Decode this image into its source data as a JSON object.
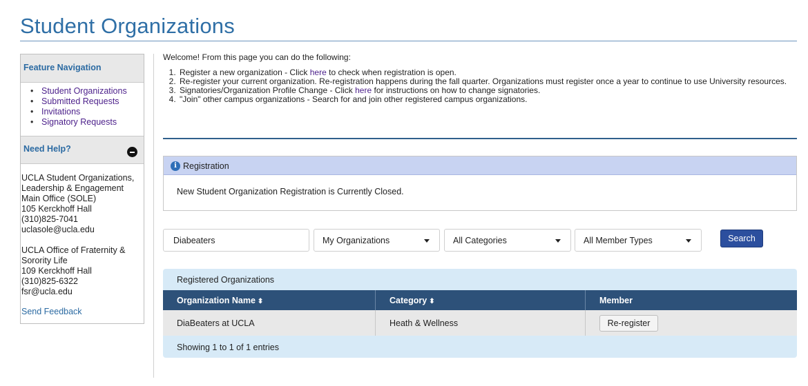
{
  "page": {
    "title": "Student Organizations"
  },
  "sidebar": {
    "nav_title": "Feature Navigation",
    "items": [
      {
        "label": "Student Organizations"
      },
      {
        "label": "Submitted Requests"
      },
      {
        "label": "Invitations"
      },
      {
        "label": "Signatory Requests"
      }
    ],
    "help_title": "Need Help?",
    "help_blocks": [
      [
        "UCLA Student Organizations,",
        "Leadership & Engagement",
        "Main Office (SOLE)",
        "105 Kerckhoff Hall",
        "(310)825-7041",
        "uclasole@ucla.edu"
      ],
      [
        "UCLA Office of Fraternity &",
        "Sorority Life",
        "109 Kerckhoff Hall",
        "(310)825-6322",
        "fsr@ucla.edu"
      ]
    ],
    "feedback_label": "Send Feedback"
  },
  "intro": {
    "welcome": "Welcome! From this page you can do the following:",
    "items": [
      {
        "before": "Register a new organization - Click ",
        "link": "here",
        "after": " to check when registration is open."
      },
      {
        "before": "Re-register your current organization. Re-registration happens during the fall quarter. Organizations must register once a year to continue to use University resources.",
        "link": "",
        "after": ""
      },
      {
        "before": "Signatories/Organization Profile Change - Click ",
        "link": "here",
        "after": " for instructions on how to change signatories."
      },
      {
        "before": "\"Join\" other campus organizations - Search for and join other registered campus organizations.",
        "link": "",
        "after": ""
      }
    ]
  },
  "registration": {
    "heading": "Registration",
    "message": "New Student Organization Registration is Currently Closed."
  },
  "search": {
    "query": "Diabeaters",
    "org_filter": "My Organizations",
    "category_filter": "All Categories",
    "member_filter": "All Member Types",
    "button_label": "Search"
  },
  "table": {
    "title": "Registered Organizations",
    "columns": [
      "Organization Name",
      "Category",
      "Member"
    ],
    "rows": [
      {
        "name": "DiaBeaters at UCLA",
        "category": "Heath & Wellness",
        "action": "Re-register"
      }
    ],
    "footer": "Showing 1 to 1 of 1 entries"
  },
  "colors": {
    "brand": "#2f6fa6",
    "table_header": "#2d5179",
    "search_button": "#2c4f9e",
    "panel_header": "#c8d3f2"
  }
}
